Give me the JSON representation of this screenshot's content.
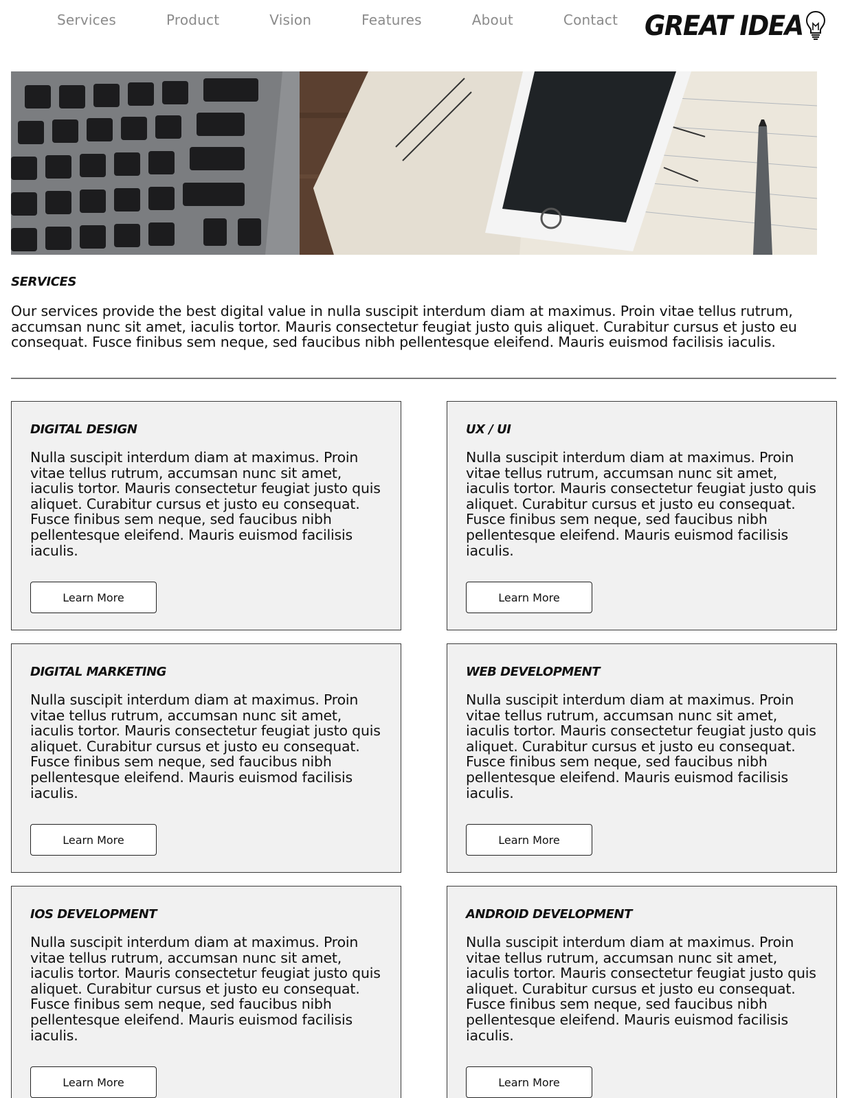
{
  "nav": {
    "links": [
      "Services",
      "Product",
      "Vision",
      "Features",
      "About",
      "Contact"
    ],
    "logo_text": "GREAT IDEA"
  },
  "hero": {
    "image": "desk-with-laptop-phone-notebook"
  },
  "services": {
    "title": "SERVICES",
    "intro": "Our services provide the best digital value in nulla suscipit interdum diam at maximus. Proin vitae tellus rutrum, accumsan nunc sit amet, iaculis tortor. Mauris consectetur feugiat justo quis aliquet. Curabitur cursus et justo eu consequat. Fusce finibus sem neque, sed faucibus nibh pellentesque eleifend. Mauris euismod facilisis iaculis."
  },
  "cards": [
    {
      "title": "DIGITAL DESIGN",
      "text": "Nulla suscipit interdum diam at maximus. Proin vitae tellus rutrum, accumsan nunc sit amet, iaculis tortor. Mauris consectetur feugiat justo quis aliquet. Curabitur cursus et justo eu consequat. Fusce finibus sem neque, sed faucibus nibh pellentesque eleifend. Mauris euismod facilisis iaculis.",
      "button": "Learn More"
    },
    {
      "title": "UX / UI",
      "text": "Nulla suscipit interdum diam at maximus. Proin vitae tellus rutrum, accumsan nunc sit amet, iaculis tortor. Mauris consectetur feugiat justo quis aliquet. Curabitur cursus et justo eu consequat. Fusce finibus sem neque, sed faucibus nibh pellentesque eleifend. Mauris euismod facilisis iaculis.",
      "button": "Learn More"
    },
    {
      "title": "DIGITAL MARKETING",
      "text": "Nulla suscipit interdum diam at maximus. Proin vitae tellus rutrum, accumsan nunc sit amet, iaculis tortor. Mauris consectetur feugiat justo quis aliquet. Curabitur cursus et justo eu consequat. Fusce finibus sem neque, sed faucibus nibh pellentesque eleifend. Mauris euismod facilisis iaculis.",
      "button": "Learn More"
    },
    {
      "title": "WEB DEVELOPMENT",
      "text": "Nulla suscipit interdum diam at maximus. Proin vitae tellus rutrum, accumsan nunc sit amet, iaculis tortor. Mauris consectetur feugiat justo quis aliquet. Curabitur cursus et justo eu consequat. Fusce finibus sem neque, sed faucibus nibh pellentesque eleifend. Mauris euismod facilisis iaculis.",
      "button": "Learn More"
    },
    {
      "title": "IOS DEVELOPMENT",
      "text": "Nulla suscipit interdum diam at maximus. Proin vitae tellus rutrum, accumsan nunc sit amet, iaculis tortor. Mauris consectetur feugiat justo quis aliquet. Curabitur cursus et justo eu consequat. Fusce finibus sem neque, sed faucibus nibh pellentesque eleifend. Mauris euismod facilisis iaculis.",
      "button": "Learn More"
    },
    {
      "title": "ANDROID DEVELOPMENT",
      "text": "Nulla suscipit interdum diam at maximus. Proin vitae tellus rutrum, accumsan nunc sit amet, iaculis tortor. Mauris consectetur feugiat justo quis aliquet. Curabitur cursus et justo eu consequat. Fusce finibus sem neque, sed faucibus nibh pellentesque eleifend. Mauris euismod facilisis iaculis.",
      "button": "Learn More"
    }
  ]
}
